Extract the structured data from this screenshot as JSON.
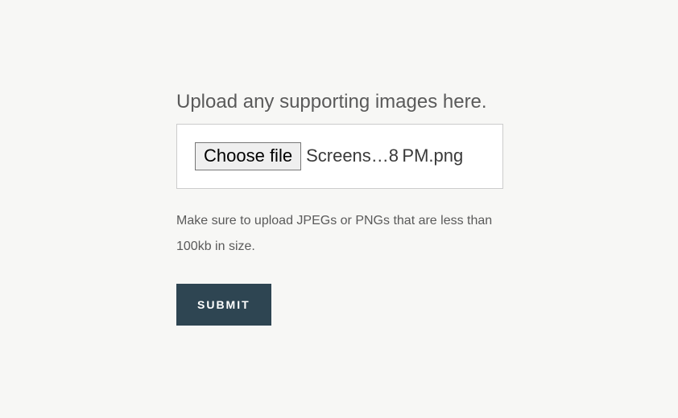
{
  "form": {
    "heading": "Upload any supporting images here.",
    "file_input": {
      "button_label": "Choose file",
      "selected_file": "Screens…8 PM.png"
    },
    "hint": "Make sure to upload JPEGs or PNGs that are less than 100kb in size.",
    "submit_label": "SUBMIT"
  }
}
